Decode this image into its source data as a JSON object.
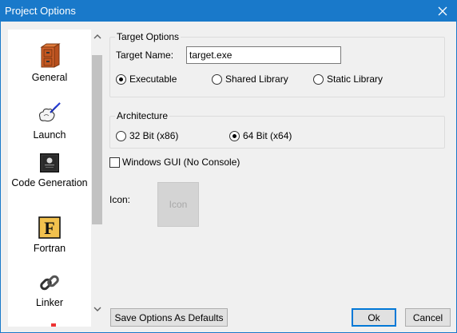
{
  "window": {
    "title": "Project Options"
  },
  "sidebar": {
    "items": [
      {
        "label": "General",
        "icon": "cabinet-icon"
      },
      {
        "label": "Launch",
        "icon": "launch-icon"
      },
      {
        "label": "Code Generation",
        "icon": "chip-icon"
      },
      {
        "label": "Fortran",
        "icon": "fortran-icon"
      },
      {
        "label": "Linker",
        "icon": "chain-link-icon"
      }
    ]
  },
  "target_options": {
    "legend": "Target Options",
    "target_name_label": "Target Name:",
    "target_name_value": "target.exe",
    "types": [
      {
        "label": "Executable",
        "selected": true
      },
      {
        "label": "Shared Library",
        "selected": false
      },
      {
        "label": "Static Library",
        "selected": false
      }
    ]
  },
  "architecture": {
    "legend": "Architecture",
    "options": [
      {
        "label": "32 Bit (x86)",
        "selected": false
      },
      {
        "label": "64 Bit (x64)",
        "selected": true
      }
    ]
  },
  "windows_gui": {
    "label": "Windows GUI (No Console)",
    "checked": false
  },
  "icon": {
    "label": "Icon:",
    "placeholder": "Icon"
  },
  "buttons": {
    "save_defaults": "Save Options As Defaults",
    "ok": "Ok",
    "cancel": "Cancel"
  },
  "colors": {
    "titlebar": "#1979ca",
    "accent": "#0078d7"
  }
}
